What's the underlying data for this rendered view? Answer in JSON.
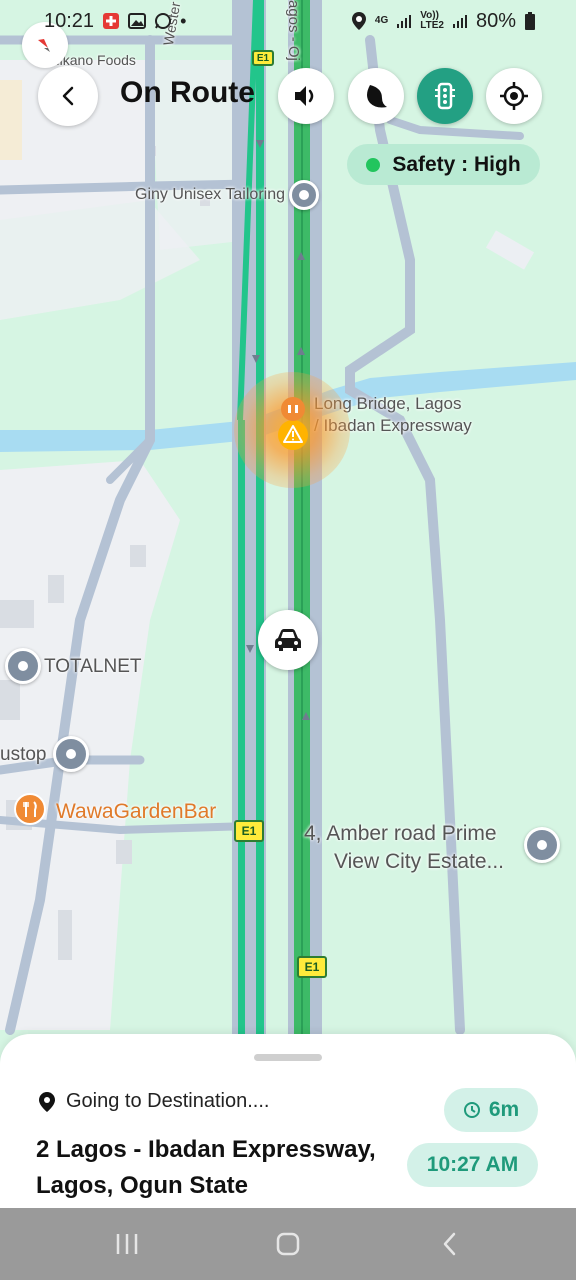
{
  "status_bar": {
    "time": "10:21",
    "battery": "80%",
    "network_top": "4G",
    "network_2_top": "Vo))",
    "network_2_bottom": "LTE2"
  },
  "header": {
    "title": "On Route",
    "safety_label": "Safety : High"
  },
  "map": {
    "labels": {
      "mikano": "Mikano Foods",
      "western": "Wester",
      "road_vertical": "agos - Oj",
      "giny": "Giny Unisex Tailoring",
      "long_bridge_line1": "Long Bridge, Lagos",
      "long_bridge_line2": "/ Ibadan Expressway",
      "totalnet": "TOTALNET",
      "busstop": "ustop",
      "wawa": "WawaGardenBar",
      "amber_line1": "4, Amber road Prime",
      "amber_line2": "View City Estate...",
      "shield": "E1"
    }
  },
  "bottom_sheet": {
    "going_label": "Going to Destination....",
    "destination": "2 Lagos - Ibadan Expressway, Lagos, Ogun State",
    "eta_duration": "6m",
    "arrival_time": "10:27 AM"
  },
  "colors": {
    "map_bg": "#d6f5e3",
    "accent": "#23a083",
    "route_green": "#3dba67",
    "route_cyan": "#22c58b",
    "water": "#a8dcf2",
    "road": "#b4c2d4",
    "safety_bg": "#b9ead3"
  }
}
